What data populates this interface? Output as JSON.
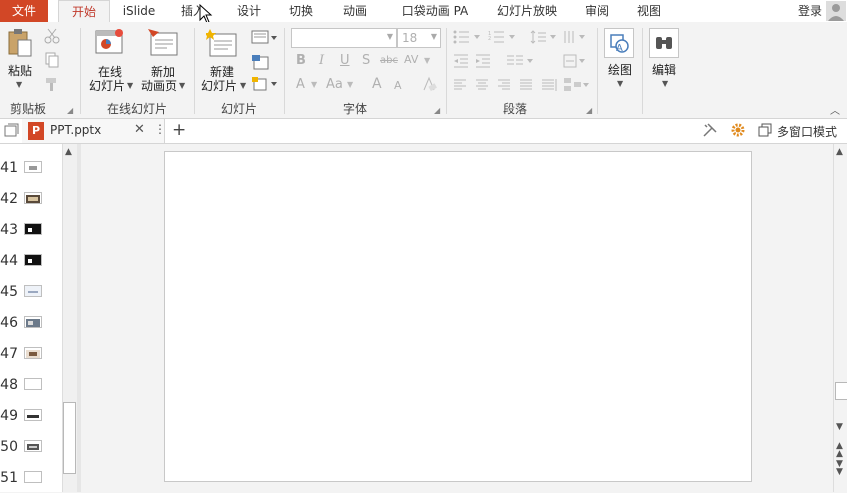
{
  "tabs": {
    "file": "文件",
    "items": [
      "开始",
      "iSlide",
      "插入",
      "设计",
      "切换",
      "动画",
      "口袋动画 PA",
      "幻灯片放映",
      "审阅",
      "视图"
    ],
    "login": "登录"
  },
  "ribbon": {
    "clipboard": {
      "paste": "粘贴",
      "group": "剪贴板"
    },
    "online_slides": {
      "online_line1": "在线",
      "online_line2": "幻灯片",
      "new_anim_line1": "新加",
      "new_anim_line2": "动画页",
      "group": "在线幻灯片"
    },
    "slides": {
      "new_line1": "新建",
      "new_line2": "幻灯片",
      "group": "幻灯片"
    },
    "font": {
      "font_name": "",
      "font_size": "18",
      "group": "字体",
      "bold": "B",
      "italic": "I",
      "underline": "U",
      "strike": "abc",
      "shadow": "S",
      "spacing": "AV",
      "case": "Aa",
      "grow": "A",
      "shrink": "A"
    },
    "paragraph": {
      "group": "段落"
    },
    "drawing": {
      "label": "绘图"
    },
    "editing": {
      "label": "编辑"
    }
  },
  "document": {
    "tab_name": "PPT.pptx",
    "multi_window": "多窗口模式"
  },
  "thumbnails": [
    {
      "num": "41"
    },
    {
      "num": "42"
    },
    {
      "num": "43"
    },
    {
      "num": "44"
    },
    {
      "num": "45"
    },
    {
      "num": "46"
    },
    {
      "num": "47"
    },
    {
      "num": "48"
    },
    {
      "num": "49"
    },
    {
      "num": "50"
    },
    {
      "num": "51"
    }
  ],
  "colors": {
    "accent": "#d24726",
    "active_tab_text": "#c0392b"
  }
}
